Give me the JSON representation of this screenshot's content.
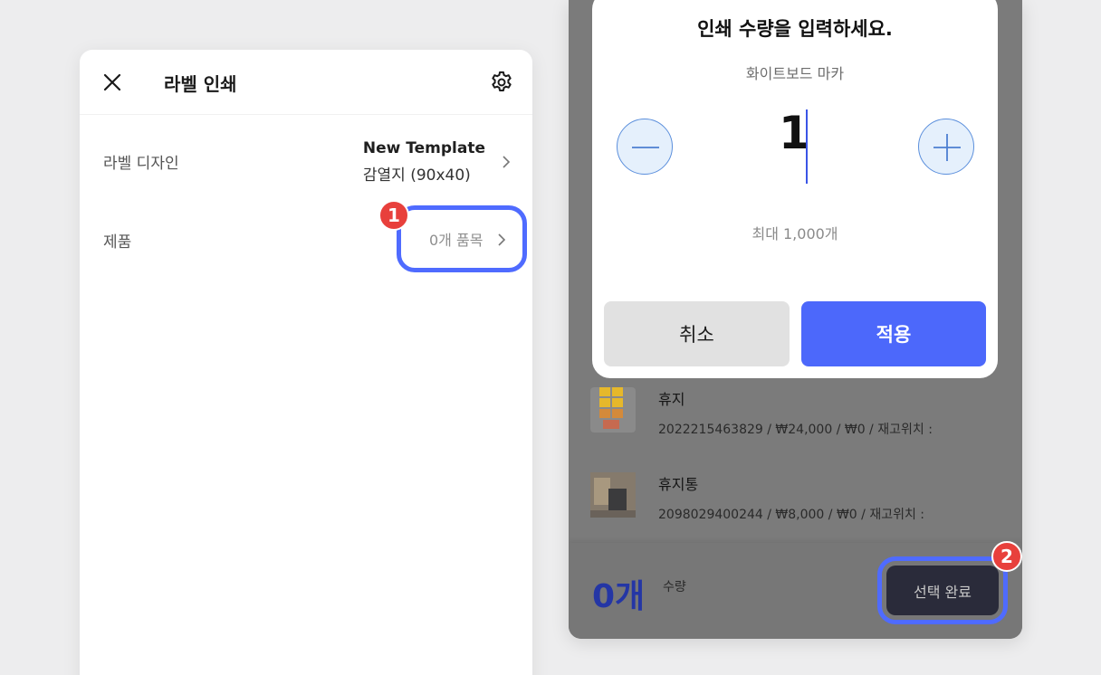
{
  "label_print": {
    "title": "라벨 인쇄",
    "design_label": "라벨 디자인",
    "design_name": "New Template",
    "design_size": "감열지 (90x40)",
    "product_label": "제품",
    "product_count": "0개 품목",
    "badge_1": "1"
  },
  "quantity_modal": {
    "title": "인쇄 수량을 입력하세요.",
    "product_name": "화이트보드 마카",
    "quantity": "1",
    "max_text": "최대 1,000개",
    "cancel_label": "취소",
    "apply_label": "적용"
  },
  "product_list": {
    "items": [
      {
        "name": "휴지",
        "meta": "2022215463829 / ₩24,000 / ₩0 / 재고위치 :"
      },
      {
        "name": "휴지통",
        "meta": "2098029400244 / ₩8,000 / ₩0 / 재고위치 :"
      }
    ]
  },
  "bottom_bar": {
    "count": "0개",
    "count_label": "수량",
    "done_label": "선택 완료",
    "badge_2": "2"
  },
  "colors": {
    "accent": "#4c68fb",
    "highlight_border": "#4f6bff",
    "badge": "#e8403c",
    "count_text": "#2436a5"
  }
}
